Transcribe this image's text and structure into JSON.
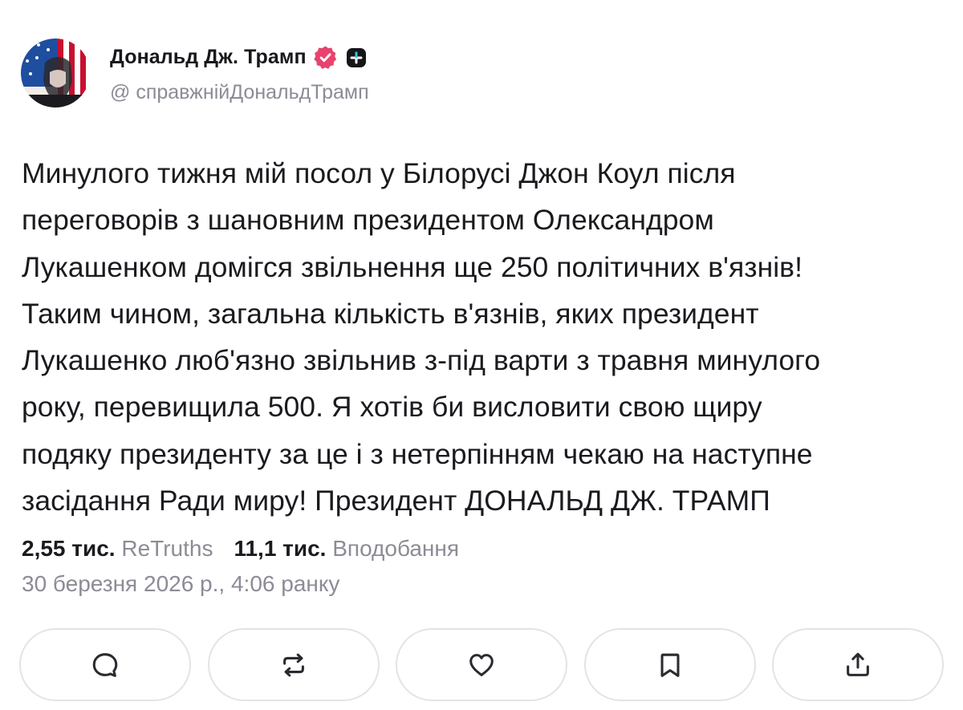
{
  "author": {
    "name": "Дональд Дж. Трамп",
    "handle": "@ справжнійДональдТрамп",
    "verified_color": "#e8436e"
  },
  "post": {
    "lines": [
      "Минулого тижня мій посол у Білорусі Джон Коул після",
      "переговорів з шановним президентом Олександром",
      "Лукашенком домігся звільнення ще 250 політичних в'язнів!",
      "Таким чином, загальна кількість в'язнів, яких президент",
      "Лукашенко люб'язно звільнив з-під варти з травня минулого",
      "року, перевищила 500. Я хотів би висловити свою щиру",
      "подяку президенту за це і з нетерпінням чекаю на наступне",
      "засідання Ради миру! Президент ДОНАЛЬД ДЖ. ТРАМП"
    ]
  },
  "stats": {
    "retruths_count": "2,55 тис.",
    "retruths_label": "ReTruths",
    "likes_count": "11,1 тис.",
    "likes_label": "Вподобання"
  },
  "timestamp": "30 березня 2026 р., 4:06 ранку",
  "actions": [
    {
      "name": "reply",
      "icon": "comment-icon"
    },
    {
      "name": "retruth",
      "icon": "repost-icon"
    },
    {
      "name": "like",
      "icon": "heart-icon"
    },
    {
      "name": "bookmark",
      "icon": "bookmark-icon"
    },
    {
      "name": "share",
      "icon": "share-icon"
    }
  ],
  "colors": {
    "text": "#1a1a1f",
    "muted": "#8b8c96",
    "accent": "#e8436e",
    "border": "#e3e3e8"
  }
}
